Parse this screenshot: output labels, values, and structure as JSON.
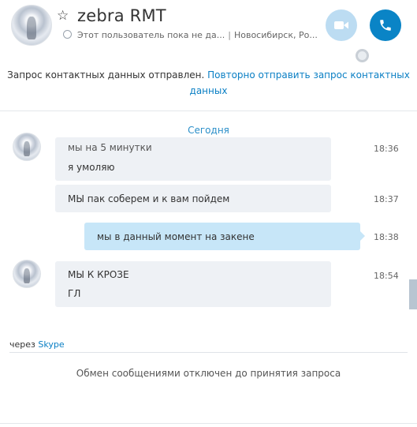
{
  "header": {
    "contact_name": "zebra RMT",
    "status_message": "Этот пользователь пока не да...",
    "separator": "|",
    "location": "Новосибирск, Ро..."
  },
  "notice": {
    "text": "Запрос контактных данных отправлен.",
    "resend_link": "Повторно отправить запрос контактных данных"
  },
  "date_divider": "Сегодня",
  "messages": [
    {
      "lines": [
        "мы на 5 минутки",
        "я умоляю"
      ],
      "time": "18:36",
      "direction": "in",
      "avatar": true
    },
    {
      "lines": [
        "МЫ пак соберем и к вам пойдем"
      ],
      "time": "18:37",
      "direction": "in",
      "avatar": false
    },
    {
      "lines": [
        "мы в данный момент на закене"
      ],
      "time": "18:38",
      "direction": "out",
      "avatar": false
    },
    {
      "lines": [
        "МЫ К КРОЗЕ",
        "ГЛ"
      ],
      "time": "18:54",
      "direction": "in",
      "avatar": true
    }
  ],
  "via": {
    "prefix": "через",
    "link": "Skype"
  },
  "disabled_notice": "Обмен сообщениями отключен до принятия запроса",
  "icons": {
    "star": "star-icon",
    "status": "status-icon",
    "video": "video-camera-icon",
    "call": "phone-icon",
    "globe": "globe-icon"
  },
  "colors": {
    "accent": "#0a84c6",
    "video_button": "#bcdcf2",
    "incoming_bubble": "#eef1f5",
    "outgoing_bubble": "#c7e6f8",
    "link": "#0a7fc4"
  }
}
